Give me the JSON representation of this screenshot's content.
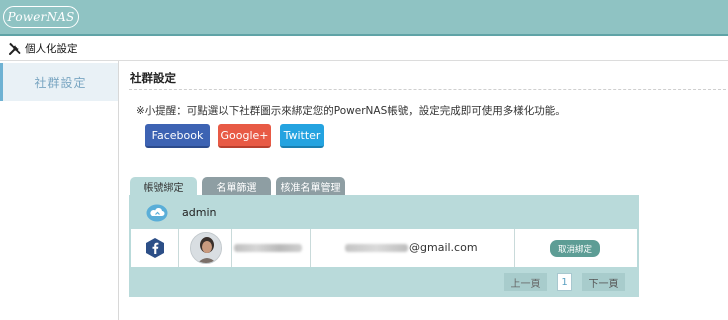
{
  "brand": {
    "logo_text": "PowerNAS"
  },
  "breadcrumb": {
    "icon": "tools-icon",
    "title": "個人化設定"
  },
  "sidebar": {
    "items": [
      {
        "label": "社群設定",
        "active": true
      }
    ]
  },
  "main": {
    "section_title": "社群設定",
    "hint": "※小提醒：可點選以下社群圖示來綁定您的PowerNAS帳號，設定完成即可使用多樣化功能。",
    "social_buttons": [
      {
        "label": "Facebook",
        "color": "#3d63b3"
      },
      {
        "label": "Google+",
        "color": "#e85a45"
      },
      {
        "label": "Twitter",
        "color": "#24a3e0"
      }
    ],
    "tabs": [
      {
        "label": "帳號綁定",
        "active": true
      },
      {
        "label": "名單篩選",
        "active": false
      },
      {
        "label": "核准名單管理",
        "active": false
      }
    ],
    "account": {
      "icon": "cloud-icon",
      "name": "admin"
    },
    "binding_row": {
      "provider_icon": "facebook-icon",
      "email_domain": "@gmail.com",
      "unbind_label": "取消綁定"
    },
    "pagination": {
      "prev": "上一頁",
      "page": "1",
      "next": "下一頁"
    }
  },
  "colors": {
    "topbar": "#8fc3c3",
    "panel": "#b9dada",
    "accent": "#5d9d95"
  }
}
